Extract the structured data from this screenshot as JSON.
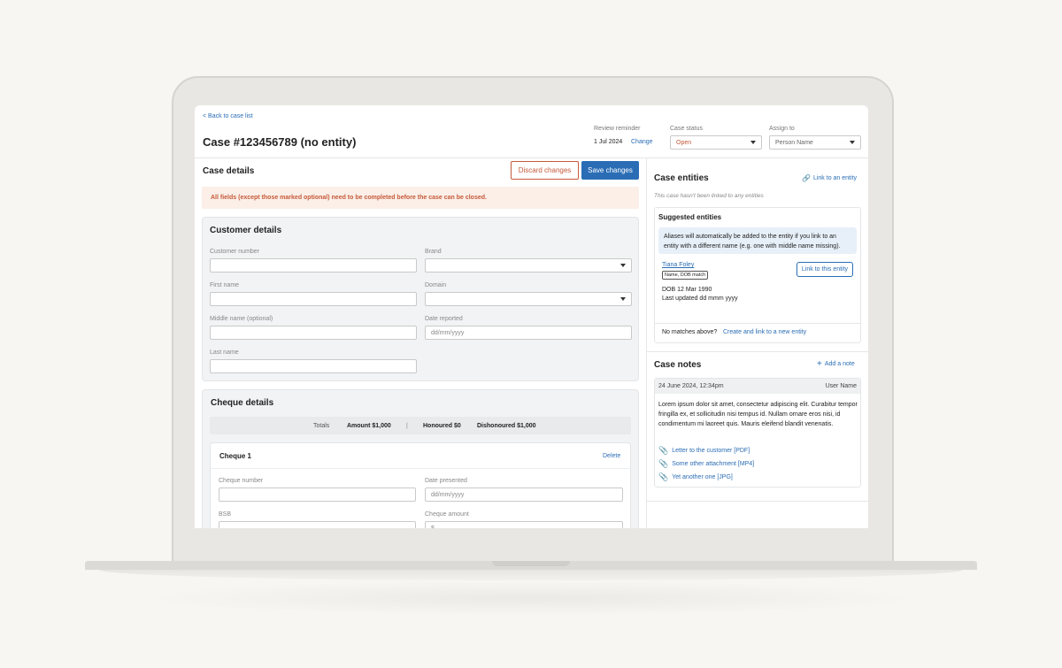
{
  "header": {
    "back_link": "< Back to case list",
    "case_title": "Case #123456789 (no entity)",
    "review_label": "Review reminder",
    "review_date": "1 Jul 2024",
    "review_change": "Change",
    "status_label": "Case status",
    "status_value": "Open",
    "assign_label": "Assign to",
    "assign_value": "Person Name"
  },
  "case_details": {
    "title": "Case details",
    "discard_label": "Discard changes",
    "save_label": "Save changes",
    "alert": "All fields (except those marked optional) need to be completed before the case can be closed."
  },
  "customer": {
    "title": "Customer details",
    "customer_number_label": "Customer number",
    "brand_label": "Brand",
    "first_name_label": "First name",
    "domain_label": "Domain",
    "middle_name_label": "Middle name (optional)",
    "date_reported_label": "Date reported",
    "date_reported_placeholder": "dd/mm/yyyy",
    "last_name_label": "Last name"
  },
  "cheque": {
    "title": "Cheque details",
    "totals_label": "Totals",
    "amount": "Amount $1,000",
    "separator": "|",
    "honoured": "Honoured $0",
    "dishonoured": "Dishonoured $1,000",
    "item_title": "Cheque 1",
    "delete_label": "Delete",
    "cheque_number_label": "Cheque number",
    "date_presented_label": "Date presented",
    "date_presented_placeholder": "dd/mm/yyyy",
    "bsb_label": "BSB",
    "cheque_amount_label": "Cheque amount",
    "cheque_amount_prefix": "$"
  },
  "entities": {
    "title": "Case entities",
    "link_label": "Link to an entity",
    "empty_text": "This case hasn't been linked to any entities",
    "suggested_title": "Suggested entities",
    "info_text": "Aliases will automatically be added to the entity if you link to an entity with a different name (e.g. one with middle name missing).",
    "person_name": "Tiana Foley",
    "match_tag": "Name, DOB match",
    "link_button": "Link to this entity",
    "dob": "DOB 12 Mar 1990",
    "last_updated": "Last updated dd mmm yyyy",
    "no_match_text": "No matches above?",
    "create_link": "Create and link to a new entity"
  },
  "notes": {
    "title": "Case notes",
    "add_label": "Add a note",
    "timestamp": "24 June 2024, 12:34pm",
    "user": "User Name",
    "body": "Lorem ipsum dolor sit amet, consectetur adipiscing elit. Curabitur tempor fringilla ex, et sollicitudin nisi tempus id. Nullam ornare eros nisi, id condimentum mi laoreet quis. Mauris eleifend blandit venenatis.",
    "attachments": [
      "Letter to the customer [PDF]",
      "Some other attachment [MP4]",
      "Yet another one [JPG]"
    ]
  },
  "colors": {
    "accent": "#2a6db5",
    "warning": "#c65a3a",
    "alert_bg": "#fbefe8"
  }
}
